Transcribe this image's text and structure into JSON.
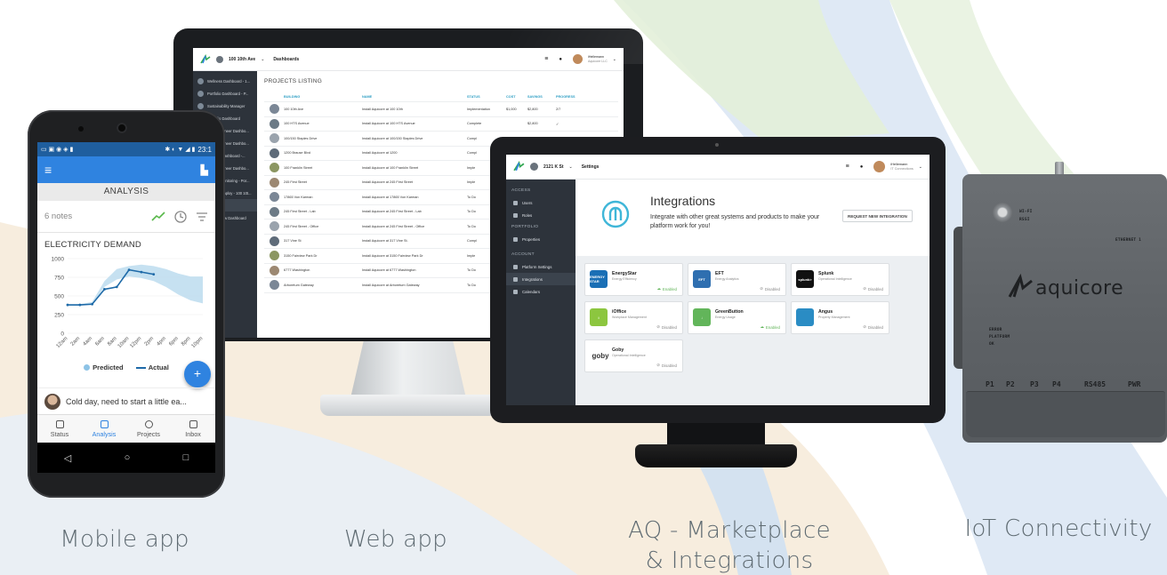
{
  "captions": {
    "mobile": "Mobile app",
    "web": "Web app",
    "marketplace_line1": "AQ - Marketplace",
    "marketplace_line2": "& Integrations",
    "iot": "IoT Connectivity"
  },
  "colors": {
    "brand_blue": "#2f83e0",
    "sidebar_dark": "#2d333b",
    "accent_teal": "#2f9fc4",
    "enabled_green": "#62b55a"
  },
  "web_app": {
    "header": {
      "building": "100 10th Ave",
      "page": "Dashboards",
      "user_name": "iHellemann",
      "user_company": "Aquicore LLC"
    },
    "sidebar": [
      {
        "label": "Wellness Dashboard - 1..."
      },
      {
        "label": "Portfolio Dashboard - P..."
      },
      {
        "label": "Sustainability Manager"
      },
      {
        "label": "Portfolio Dashboard"
      },
      {
        "label": "Chief Engineer Dashbo..."
      },
      {
        "label": "Chief Engineer Dashbo..."
      },
      {
        "label": "Finance Dashboard -..."
      },
      {
        "label": "Chief Engineer Dashbo..."
      },
      {
        "label": "Energy Monitoring - Por..."
      },
      {
        "label": "Energy Employ - 100 10t..."
      },
      {
        "label": "Reporting"
      },
      {
        "label": "Create New Dashboard"
      }
    ],
    "projects_title": "PROJECTS LISTING",
    "columns": [
      "",
      "BUILDING",
      "NAME",
      "STATUS",
      "COST",
      "SAVINGS",
      "PROGRESS"
    ],
    "rows": [
      {
        "building": "100 10th Ave",
        "name": "Install Aquicore at 100 10th",
        "status": "Implementation",
        "cost": "$1,000",
        "savings": "$2,800",
        "progress": "2/7"
      },
      {
        "building": "100 HTS Avenue",
        "name": "Install Aquicore at 100 HTS Avenue",
        "status": "Complete",
        "cost": "",
        "savings": "$2,800",
        "progress": "✓"
      },
      {
        "building": "100/150 Staples Drive",
        "name": "Install Aquicore at 100/150 Staples Drive",
        "status": "Compl",
        "cost": "",
        "savings": "",
        "progress": ""
      },
      {
        "building": "1200 Brause Blvd",
        "name": "Install Aquicore at 1200",
        "status": "Compl",
        "cost": "",
        "savings": "",
        "progress": ""
      },
      {
        "building": "100 Franklin Street",
        "name": "Install Aquicore at 100 Franklin Street",
        "status": "Imple",
        "cost": "",
        "savings": "",
        "progress": ""
      },
      {
        "building": "245 First Street",
        "name": "Install Aquicore at 245 First Street",
        "status": "Imple",
        "cost": "",
        "savings": "",
        "progress": ""
      },
      {
        "building": "17865 Von Karman",
        "name": "Install Aquicore at 17865 Von Karman",
        "status": "To Do",
        "cost": "",
        "savings": "",
        "progress": ""
      },
      {
        "building": "245 First Street - Lab",
        "name": "Install Aquicore at 245 First Street - Lab",
        "status": "To Do",
        "cost": "",
        "savings": "",
        "progress": ""
      },
      {
        "building": "245 First Street - Office",
        "name": "Install Aquicore at 245 First Street - Office",
        "status": "To Do",
        "cost": "",
        "savings": "",
        "progress": ""
      },
      {
        "building": "317 Vine St",
        "name": "Install Aquicore at 317 Vine St.",
        "status": "Compl",
        "cost": "",
        "savings": "",
        "progress": ""
      },
      {
        "building": "3150 Fairview Park Dr",
        "name": "Install Aquicore at 3150 Fairview Park Dr",
        "status": "Imple",
        "cost": "",
        "savings": "",
        "progress": ""
      },
      {
        "building": "6777 Washington",
        "name": "Install Aquicore at 6777 Washington",
        "status": "To Do",
        "cost": "",
        "savings": "",
        "progress": ""
      },
      {
        "building": "Arboretum Gateway",
        "name": "Install Aquicore at Arboretum Gateway",
        "status": "To Do",
        "cost": "",
        "savings": "",
        "progress": ""
      }
    ]
  },
  "marketplace": {
    "header": {
      "building": "2121 K St",
      "page": "Settings",
      "user_name": "iHellemann",
      "user_company": "IT Connections"
    },
    "sidebar": {
      "access_label": "ACCESS",
      "access_items": [
        "Users",
        "Roles"
      ],
      "portfolio_label": "PORTFOLIO",
      "portfolio_items": [
        "Properties"
      ],
      "account_label": "ACCOUNT",
      "account_items": [
        "Platform Settings",
        "Integrations",
        "Calendars"
      ]
    },
    "title": "Integrations",
    "description": "Integrate with other great systems and products to make your platform work for you!",
    "request_button": "REQUEST NEW INTEGRATION",
    "integrations": [
      {
        "name": "EnergyStar",
        "subtitle": "Energy Efficiency",
        "status": "Enabled",
        "enabled": true,
        "color": "#1a6fb5",
        "logo_text": "ENERGY STAR"
      },
      {
        "name": "EFT",
        "subtitle": "Energy Analytics",
        "status": "Disabled",
        "enabled": false,
        "color": "#2f6fb0",
        "logo_text": "EFT"
      },
      {
        "name": "Splunk",
        "subtitle": "Operational Intelligence",
        "status": "Disabled",
        "enabled": false,
        "color": "#111111",
        "logo_text": "splunk>"
      },
      {
        "name": "iOffice",
        "subtitle": "Workplace Management",
        "status": "Disabled",
        "enabled": false,
        "color": "#8cc63f",
        "logo_text": "i"
      },
      {
        "name": "GreenButton",
        "subtitle": "Energy Usage",
        "status": "Enabled",
        "enabled": true,
        "color": "#62b55a",
        "logo_text": "↓"
      },
      {
        "name": "Angus",
        "subtitle": "Property Management",
        "status": "Disabled",
        "enabled": false,
        "color": "#2a8cc4",
        "logo_text": ""
      },
      {
        "name": "Goby",
        "subtitle": "Operational Intelligence",
        "status": "Disabled",
        "enabled": false,
        "color": "#ffffff",
        "logo_text": "goby"
      }
    ]
  },
  "mobile_app": {
    "status_time": "23:1",
    "screen_title": "ANALYSIS",
    "notes_label": "6 notes",
    "chart_title": "ELECTRICITY DEMAND",
    "legend_predicted": "Predicted",
    "legend_actual": "Actual",
    "fab_label": "+",
    "comment": "Cold day, need to start a little ea...",
    "tabs": [
      {
        "label": "Status",
        "active": false
      },
      {
        "label": "Analysis",
        "active": true
      },
      {
        "label": "Projects",
        "active": false
      },
      {
        "label": "Inbox",
        "active": false
      }
    ],
    "nav": [
      "◁",
      "○",
      "□"
    ]
  },
  "chart_data": {
    "type": "area",
    "title": "ELECTRICITY DEMAND",
    "xlabel": "",
    "ylabel": "",
    "categories": [
      "12am",
      "2am",
      "4am",
      "6am",
      "8am",
      "10am",
      "12pm",
      "2pm",
      "4pm",
      "6pm",
      "8pm",
      "10pm"
    ],
    "ylim": [
      0,
      1000
    ],
    "yticks": [
      0,
      250,
      500,
      750,
      1000
    ],
    "series": [
      {
        "name": "Predicted",
        "kind": "band",
        "lower": [
          370,
          370,
          390,
          620,
          720,
          760,
          740,
          700,
          620,
          520,
          440,
          400
        ],
        "upper": [
          380,
          390,
          420,
          700,
          860,
          900,
          920,
          900,
          860,
          800,
          760,
          760
        ]
      },
      {
        "name": "Actual",
        "kind": "line",
        "values": [
          380,
          380,
          390,
          590,
          620,
          850,
          820,
          790,
          null,
          null,
          null,
          null
        ]
      }
    ]
  },
  "iot_device": {
    "brand": "aquicore",
    "led_labels": [
      "WI-FI",
      "RSSI"
    ],
    "top_right_label": "ETHERNET 1",
    "status_labels": [
      "ERROR",
      "PLATFORM",
      "OK"
    ],
    "ports": [
      "P1",
      "P2",
      "P3",
      "P4",
      "RS485",
      "PWR"
    ]
  }
}
